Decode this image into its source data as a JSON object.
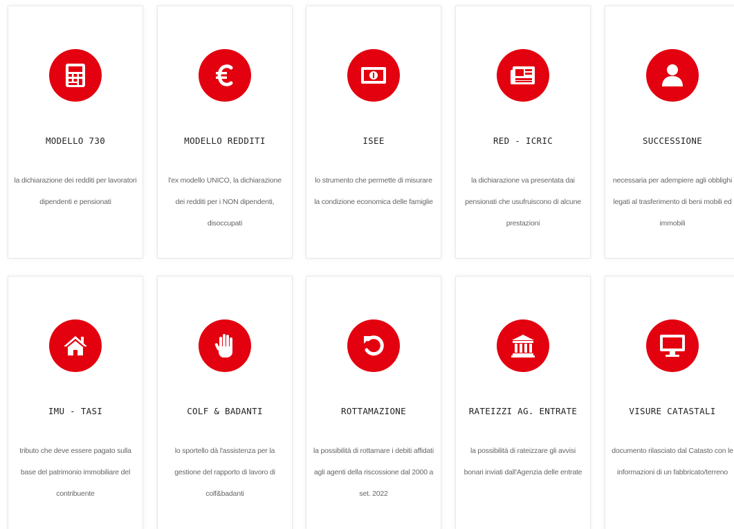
{
  "colors": {
    "accent": "#e3000f",
    "title_text": "#222222",
    "desc_text": "#666666",
    "card_border": "#e8e8e8"
  },
  "services": [
    {
      "icon": "calculator-icon",
      "title": "MODELLO 730",
      "description": "la dichiarazione dei redditi per lavoratori dipendenti e pensionati"
    },
    {
      "icon": "euro-icon",
      "title": "MODELLO REDDITI",
      "description": "l'ex modello UNICO, la dichiarazione dei redditi per i NON dipendenti, disoccupati"
    },
    {
      "icon": "money-bill-icon",
      "title": "ISEE",
      "description": "lo strumento che permette di misurare la condizione economica delle famiglie"
    },
    {
      "icon": "newspaper-icon",
      "title": "RED - ICRIC",
      "description": "la dichiarazione va presentata dai pensionati che usufruiscono di alcune prestazioni"
    },
    {
      "icon": "user-icon",
      "title": "SUCCESSIONE",
      "description": "necessaria per adempiere agli obblighi legati al trasferimento di beni mobili ed immobili"
    },
    {
      "icon": "home-icon",
      "title": "IMU - TASI",
      "description": "tributo che deve essere pagato sulla base del patrimonio immobiliare del contribuente"
    },
    {
      "icon": "hand-icon",
      "title": "COLF & BADANTI",
      "description": "lo sportello dà l'assistenza per la gestione del rapporto di lavoro di colf&badanti"
    },
    {
      "icon": "undo-icon",
      "title": "ROTTAMAZIONE",
      "description": "la possibilità di rottamare i debiti affidati agli agenti della riscossione dal 2000 a set. 2022"
    },
    {
      "icon": "bank-icon",
      "title": "RATEIZZI AG. ENTRATE",
      "description": "la possibilità di rateizzare gli avvisi bonari inviati dall'Agenzia delle entrate"
    },
    {
      "icon": "desktop-icon",
      "title": "VISURE CATASTALI",
      "description": "documento rilasciato dal Catasto con le informazioni di un fabbricato/terreno"
    }
  ]
}
